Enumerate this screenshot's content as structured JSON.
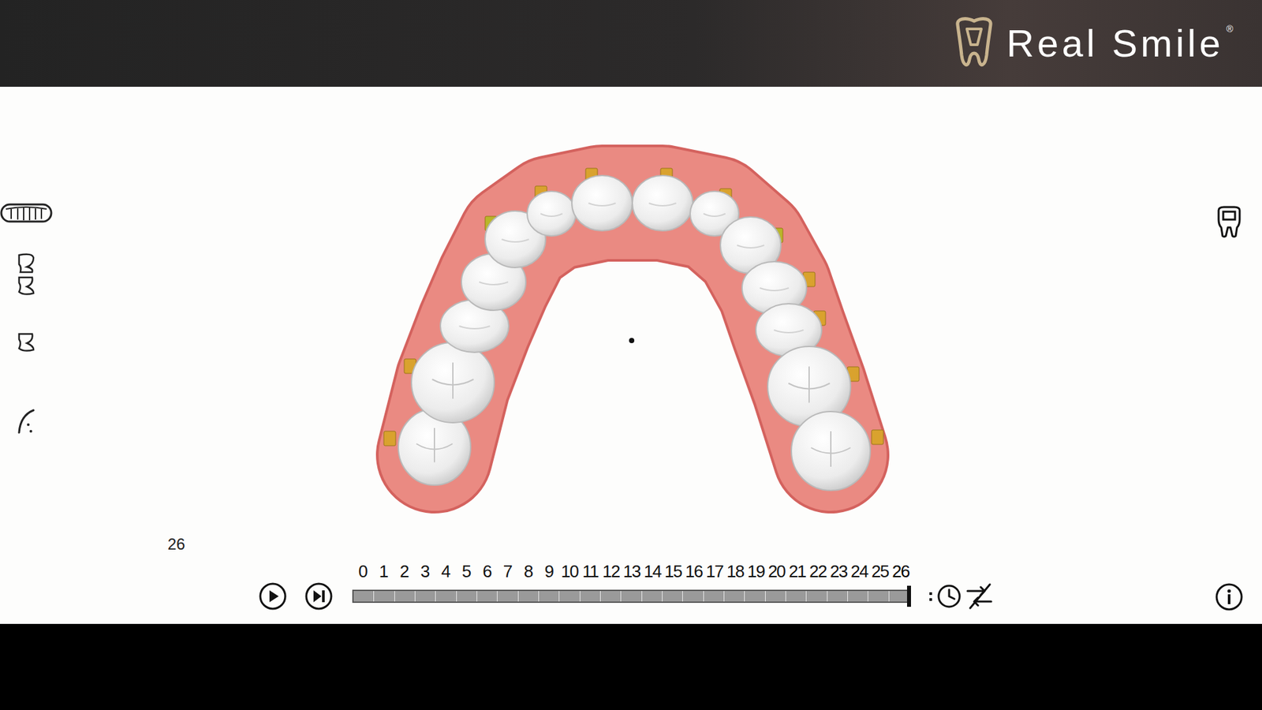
{
  "header": {
    "brand": "Real Smile",
    "trademark": "®"
  },
  "player": {
    "current_stage": "26",
    "level": 1,
    "stages": [
      {
        "label": "0",
        "selected": false
      },
      {
        "label": "1",
        "selected": false
      },
      {
        "label": "2",
        "selected": false
      },
      {
        "label": "3",
        "selected": false
      },
      {
        "label": "4",
        "selected": false
      },
      {
        "label": "5",
        "selected": false
      },
      {
        "label": "6",
        "selected": false
      },
      {
        "label": "7",
        "selected": false
      },
      {
        "label": "8",
        "selected": false
      },
      {
        "label": "9",
        "selected": false
      },
      {
        "label": "10",
        "selected": false
      },
      {
        "label": "11",
        "selected": false
      },
      {
        "label": "12",
        "selected": false
      },
      {
        "label": "13",
        "selected": false
      },
      {
        "label": "14",
        "selected": false
      },
      {
        "label": "15",
        "selected": false
      },
      {
        "label": "16",
        "selected": false
      },
      {
        "label": "17",
        "selected": false
      },
      {
        "label": "18",
        "selected": false
      },
      {
        "label": "19",
        "selected": false
      },
      {
        "label": "20",
        "selected": false
      },
      {
        "label": "21",
        "selected": false
      },
      {
        "label": "22",
        "selected": false
      },
      {
        "label": "23",
        "selected": false
      },
      {
        "label": "24",
        "selected": false
      },
      {
        "label": "25",
        "selected": false
      },
      {
        "label": "26",
        "selected": true
      }
    ]
  }
}
